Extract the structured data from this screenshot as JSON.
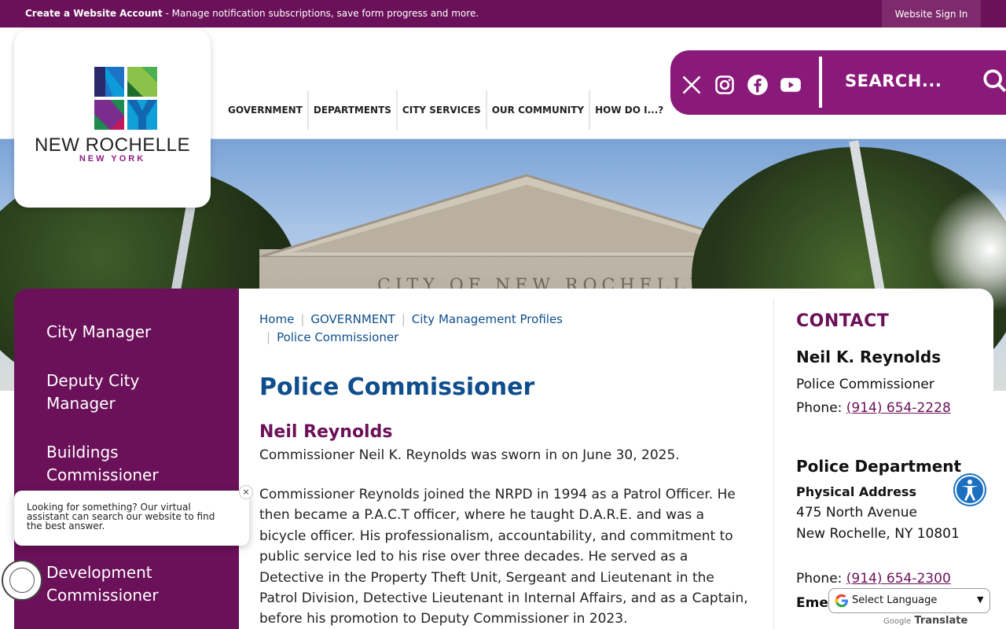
{
  "topbar": {
    "account_bold": "Create a Website Account",
    "account_rest": " - Manage notification subscriptions, save form progress and more.",
    "signin_label": "Website Sign In"
  },
  "logo": {
    "letters": "NRNY",
    "city": "NEW ROCHELLE",
    "state": "NEW YORK"
  },
  "nav": {
    "items": [
      "GOVERNMENT",
      "DEPARTMENTS",
      "CITY SERVICES",
      "OUR COMMUNITY",
      "HOW DO I...?"
    ]
  },
  "search": {
    "placeholder": "SEARCH..."
  },
  "social": {
    "icons": [
      "x-icon",
      "instagram-icon",
      "facebook-icon",
      "youtube-icon"
    ]
  },
  "hero": {
    "engraving": "CITY OF NEW ROCHELLE"
  },
  "sidenav": {
    "items": [
      "City Manager",
      "Deputy City Manager",
      "Buildings Commissioner",
      "Development Commissioner"
    ]
  },
  "breadcrumb": [
    "Home",
    "GOVERNMENT",
    "City Management Profiles",
    "Police Commissioner"
  ],
  "page": {
    "title": "Police Commissioner",
    "subhead": "Neil Reynolds",
    "para1": "Commissioner Neil K. Reynolds was sworn in on June 30, 2025.",
    "para2": "Commissioner Reynolds joined the NRPD in 1994 as a Patrol Officer.  He then became a P.A.C.T officer, where he taught D.A.R.E. and was a bicycle officer. His professionalism, accountability, and commitment to public service led to his rise over three decades. He served as a Detective in the Property Theft Unit, Sergeant and Lieutenant in the Patrol Division, Detective Lieutenant in Internal Affairs, and as a Captain, before his promotion to Deputy Commissioner in 2023."
  },
  "contact": {
    "heading": "CONTACT",
    "name": "Neil K. Reynolds",
    "role": "Police Commissioner",
    "phone_label": "Phone: ",
    "phone1": "(914) 654-2228",
    "dept": "Police Department",
    "addr_heading": "Physical Address",
    "addr1": "475 North Avenue",
    "addr2": "New Rochelle, NY 10801",
    "phone2": "(914) 654-2300",
    "emer_partial": "Emer"
  },
  "chat": {
    "text": "Looking for something? Our virtual assistant can search our website to find the best answer.",
    "close": "×"
  },
  "translate": {
    "select_label": "Select Language",
    "powered_google": "Google",
    "powered_translate": "Translate"
  },
  "colors": {
    "brand_purple": "#6b1159",
    "accent_purple": "#8a1a7a",
    "link_blue": "#0f4e8c"
  }
}
